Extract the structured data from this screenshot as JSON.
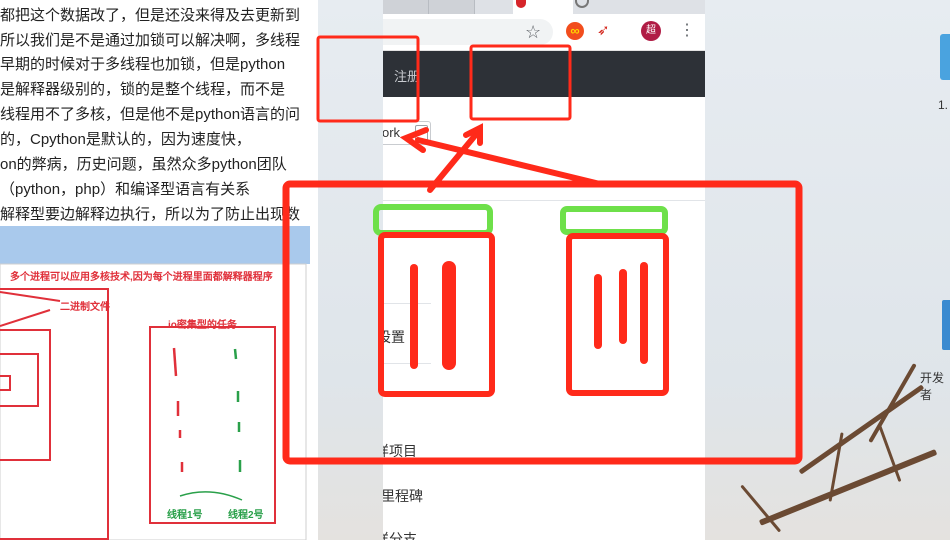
{
  "document": {
    "lines": [
      "都把这个数据改了，但是还没来得及去更新到",
      "所以我们是不是通过加锁可以解决啊，多线程",
      "早期的时候对于多线程也加锁，但是python",
      "是解释器级别的，锁的是整个线程，而不是",
      "线程用不了多核，但是他不是python语言的问",
      "的，Cpython是默认的，因为速度快，",
      "on的弊病，历史问题，虽然众多python团队",
      "（python，php）和编译型语言有关系",
      "解释型要边解释边执行，所以为了防止出现数"
    ],
    "image": {
      "title": "多个进程可以应用多核技术,因为每个进程里面都解释器程序",
      "binary_label": "二进制文件",
      "io_label": "io密集型的任务",
      "thread1": "线程1号",
      "thread2": "线程2号"
    }
  },
  "browser": {
    "nav": {
      "register": "注册"
    },
    "select_value": "ork",
    "sidebar": {
      "settings": "设置",
      "item1": "样项目",
      "item2": "里程碑",
      "item3": "样分支"
    },
    "profile_initial": "超",
    "icons": [
      "star-icon",
      "infinity-extension-icon",
      "rocket-extension-icon",
      "kebab-menu-icon"
    ]
  },
  "desktop": {
    "icon1_label": "1.",
    "icon2_label": "开发者"
  },
  "colors": {
    "annotation_red": "#ff2a1a",
    "annotation_green": "#6ee04a",
    "nav_bg": "#2d3137"
  }
}
